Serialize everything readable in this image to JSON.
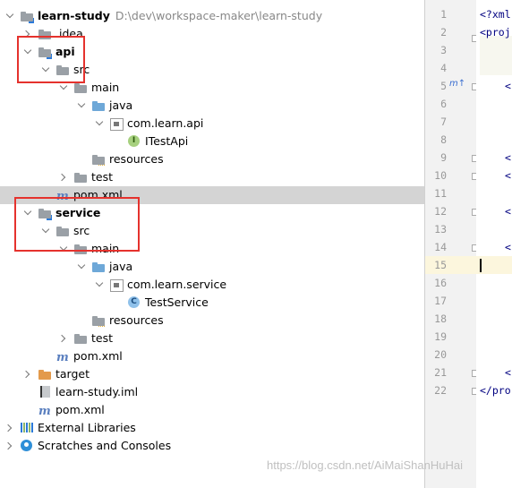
{
  "tree": {
    "root": {
      "label": "learn-study",
      "path": "D:\\dev\\workspace-maker\\learn-study"
    },
    "idea": ".idea",
    "api": {
      "label": "api",
      "src": "src",
      "main": "main",
      "java": "java",
      "package": "com.learn.api",
      "class": "ITestApi",
      "resources": "resources",
      "test": "test",
      "pom": "pom.xml"
    },
    "service": {
      "label": "service",
      "src": "src",
      "main": "main",
      "java": "java",
      "package": "com.learn.service",
      "class": "TestService",
      "resources": "resources",
      "test": "test",
      "pom": "pom.xml"
    },
    "target": "target",
    "iml": "learn-study.iml",
    "pom": "pom.xml",
    "external_libraries": "External Libraries",
    "scratches": "Scratches and Consoles"
  },
  "editor": {
    "line_numbers": [
      "1",
      "2",
      "3",
      "4",
      "5",
      "6",
      "7",
      "8",
      "9",
      "10",
      "11",
      "12",
      "13",
      "14",
      "15",
      "16",
      "17",
      "18",
      "19",
      "20",
      "21",
      "22"
    ],
    "current_line": "15",
    "code_lines": {
      "l1": "<?xml",
      "l2": "<proj",
      "l22": "</pro"
    }
  },
  "watermark": "https://blog.csdn.net/AiMaiShanHuHai",
  "colors": {
    "selection": "#d4d4d4",
    "highlight_box": "#e5322d",
    "gutter": "#f2f2f2",
    "current_line": "#fcf6dd"
  }
}
